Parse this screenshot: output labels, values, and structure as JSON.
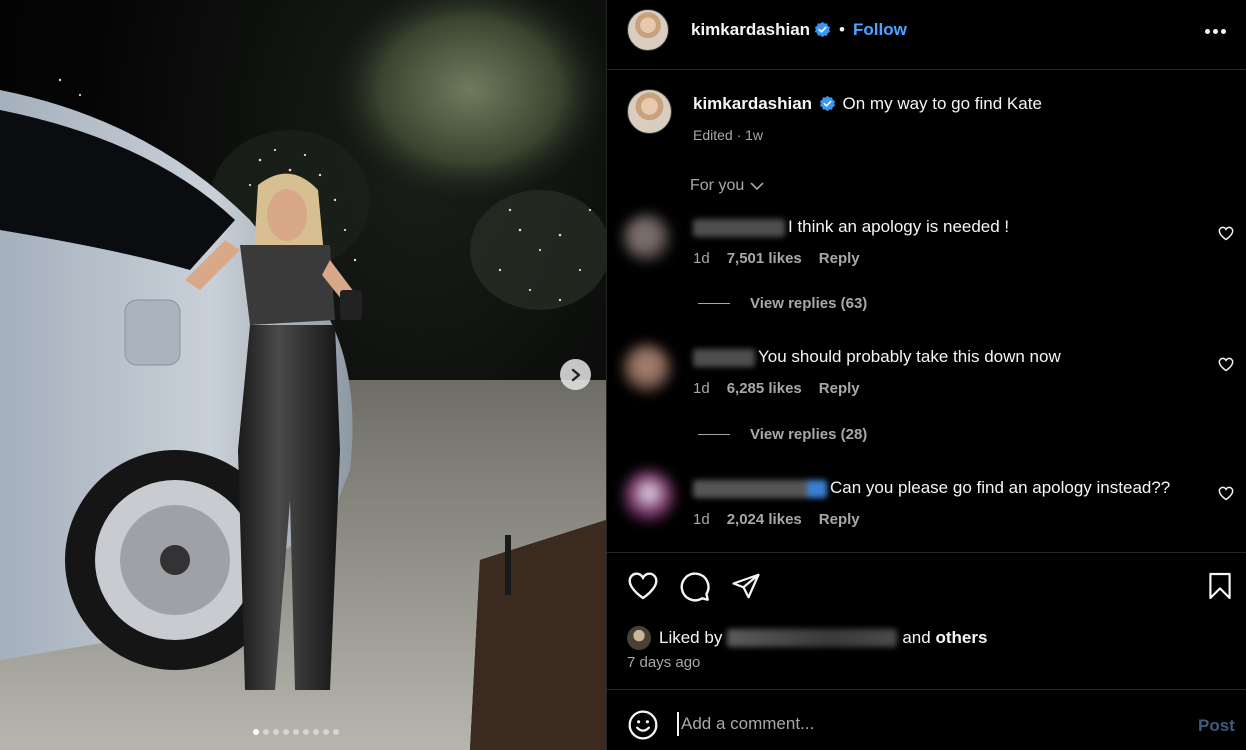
{
  "post": {
    "username": "kimkardashian",
    "follow_label": "Follow",
    "separator": "•",
    "caption": "On my way to go find Kate",
    "caption_meta": "Edited · 1w",
    "sort_label": "For you",
    "slide_count": 9,
    "active_slide": 1
  },
  "comments": [
    {
      "text": "I think an apology is needed !",
      "time": "1d",
      "likes": "7,501 likes",
      "reply": "Reply",
      "view_replies": "View replies (63)"
    },
    {
      "text": "You should probably take this down now",
      "time": "1d",
      "likes": "6,285 likes",
      "reply": "Reply",
      "view_replies": "View replies (28)"
    },
    {
      "text": "Can you please go find an apology instead??",
      "time": "1d",
      "likes": "2,024 likes",
      "reply": "Reply"
    }
  ],
  "footer": {
    "liked_by": "Liked by",
    "and_others_and": "and",
    "and_others_others": "others",
    "posted": "7 days ago",
    "comment_placeholder": "Add a comment...",
    "post_label": "Post"
  },
  "colors": {
    "accent": "#4aa6ff",
    "verified": "#3897f0",
    "muted": "#a8a8a8",
    "post_disabled": "#3f5a7a"
  },
  "icons": {
    "like": "heart-icon",
    "comment": "comment-icon",
    "share": "share-icon",
    "save": "bookmark-icon",
    "emoji": "emoji-icon",
    "next": "chevron-right-icon",
    "more": "more-options-icon"
  }
}
